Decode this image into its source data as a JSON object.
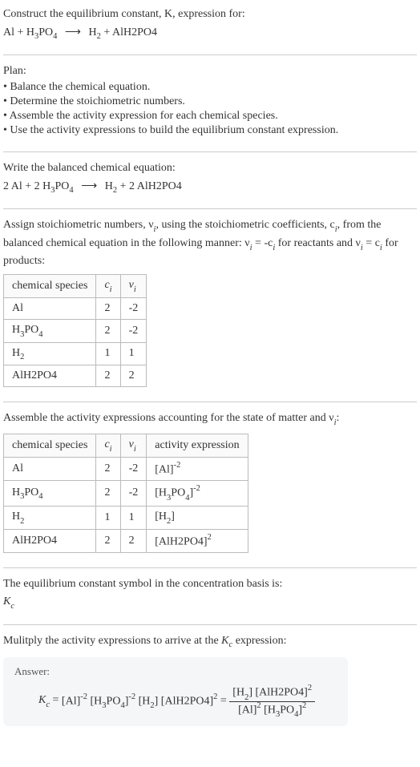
{
  "prompt": {
    "line1": "Construct the equilibrium constant, K, expression for:",
    "equation_raw": "Al + H3PO4 ⟶ H2 + AlH2PO4"
  },
  "plan": {
    "heading": "Plan:",
    "items": [
      "• Balance the chemical equation.",
      "• Determine the stoichiometric numbers.",
      "• Assemble the activity expression for each chemical species.",
      "• Use the activity expressions to build the equilibrium constant expression."
    ]
  },
  "balanced": {
    "heading": "Write the balanced chemical equation:",
    "equation_raw": "2 Al + 2 H3PO4 ⟶ H2 + 2 AlH2PO4"
  },
  "assign": {
    "text_prefix": "Assign stoichiometric numbers, ν",
    "text_mid1": ", using the stoichiometric coefficients, c",
    "text_mid2": ", from the balanced chemical equation in the following manner: ν",
    "text_mid3": " = -c",
    "text_mid4": " for reactants and ν",
    "text_mid5": " = c",
    "text_end": " for products:",
    "table": {
      "headers": [
        "chemical species",
        "cᵢ",
        "νᵢ"
      ],
      "rows": [
        {
          "species": "Al",
          "c": "2",
          "nu": "-2"
        },
        {
          "species": "H3PO4",
          "c": "2",
          "nu": "-2"
        },
        {
          "species": "H2",
          "c": "1",
          "nu": "1"
        },
        {
          "species": "AlH2PO4",
          "c": "2",
          "nu": "2"
        }
      ]
    }
  },
  "activity": {
    "heading": "Assemble the activity expressions accounting for the state of matter and ν",
    "heading_end": ":",
    "table": {
      "headers": [
        "chemical species",
        "cᵢ",
        "νᵢ",
        "activity expression"
      ],
      "rows": [
        {
          "species": "Al",
          "c": "2",
          "nu": "-2",
          "expr_base": "[Al]",
          "expr_exp": "-2"
        },
        {
          "species": "H3PO4",
          "c": "2",
          "nu": "-2",
          "expr_base": "[H3PO4]",
          "expr_exp": "-2"
        },
        {
          "species": "H2",
          "c": "1",
          "nu": "1",
          "expr_base": "[H2]",
          "expr_exp": ""
        },
        {
          "species": "AlH2PO4",
          "c": "2",
          "nu": "2",
          "expr_base": "[AlH2PO4]",
          "expr_exp": "2"
        }
      ]
    }
  },
  "symbol_line": {
    "text": "The equilibrium constant symbol in the concentration basis is:",
    "sym_base": "K",
    "sym_sub": "c"
  },
  "multiply_line": {
    "prefix": "Mulitply the activity expressions to arrive at the ",
    "sym_base": "K",
    "sym_sub": "c",
    "suffix": " expression:"
  },
  "answer": {
    "label": "Answer:",
    "lhs_base": "K",
    "lhs_sub": "c",
    "terms": [
      {
        "base": "[Al]",
        "exp": "-2"
      },
      {
        "base": "[H3PO4]",
        "exp": "-2"
      },
      {
        "base": "[H2]",
        "exp": ""
      },
      {
        "base": "[AlH2PO4]",
        "exp": "2"
      }
    ],
    "frac_num": [
      {
        "base": "[H2]",
        "exp": ""
      },
      {
        "base": "[AlH2PO4]",
        "exp": "2"
      }
    ],
    "frac_den": [
      {
        "base": "[Al]",
        "exp": "2"
      },
      {
        "base": "[H3PO4]",
        "exp": "2"
      }
    ]
  },
  "chart_data": {
    "type": "table",
    "tables": [
      {
        "title": "Stoichiometric numbers",
        "columns": [
          "chemical species",
          "c_i",
          "nu_i"
        ],
        "rows": [
          [
            "Al",
            2,
            -2
          ],
          [
            "H3PO4",
            2,
            -2
          ],
          [
            "H2",
            1,
            1
          ],
          [
            "AlH2PO4",
            2,
            2
          ]
        ]
      },
      {
        "title": "Activity expressions",
        "columns": [
          "chemical species",
          "c_i",
          "nu_i",
          "activity expression"
        ],
        "rows": [
          [
            "Al",
            2,
            -2,
            "[Al]^-2"
          ],
          [
            "H3PO4",
            2,
            -2,
            "[H3PO4]^-2"
          ],
          [
            "H2",
            1,
            1,
            "[H2]"
          ],
          [
            "AlH2PO4",
            2,
            2,
            "[AlH2PO4]^2"
          ]
        ]
      }
    ]
  }
}
